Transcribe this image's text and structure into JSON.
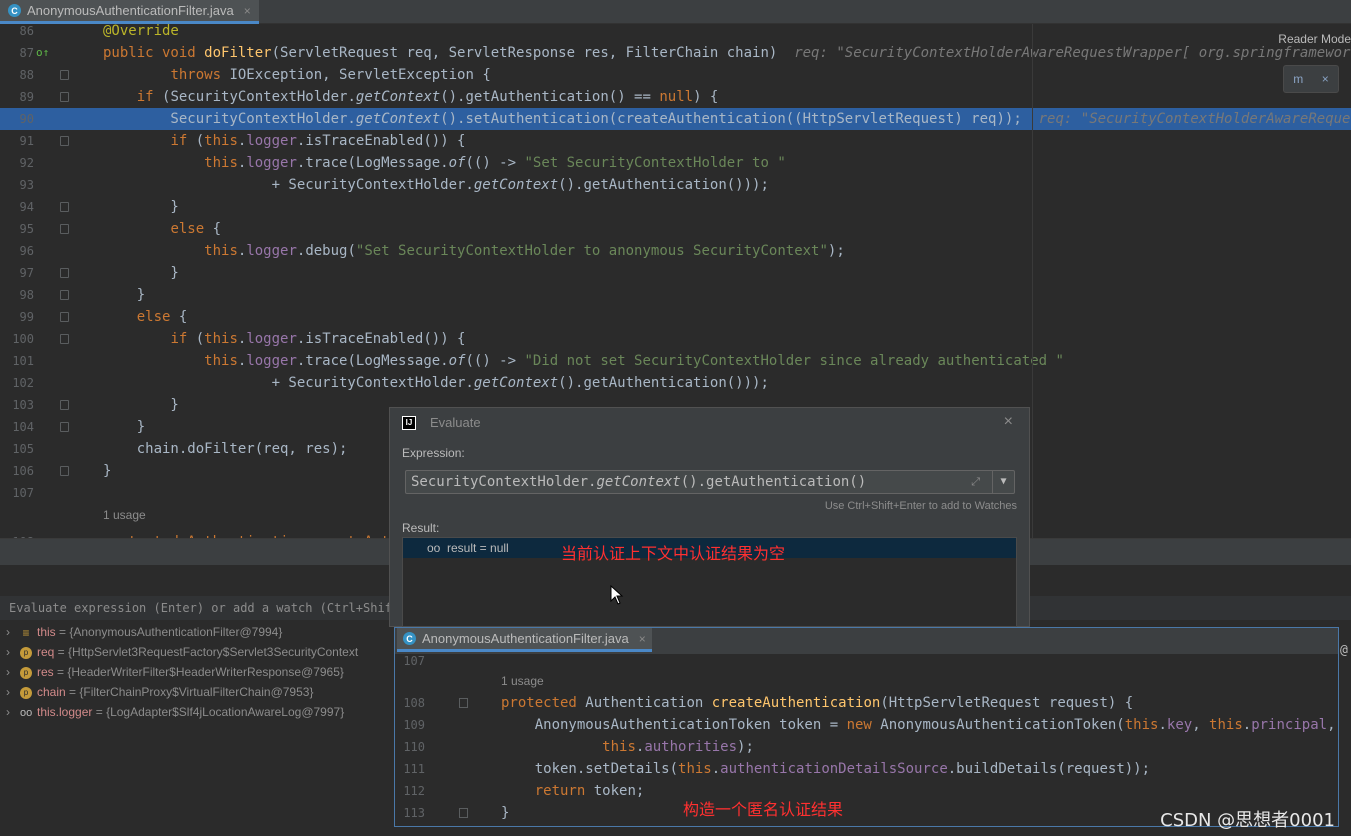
{
  "tab": {
    "icon": "C",
    "label": "AnonymousAuthenticationFilter.java",
    "close": "×"
  },
  "reader_mode": "Reader Mode",
  "maven_icon": "m",
  "maven_close": "×",
  "editor": {
    "lines": [
      {
        "n": "86",
        "parts": [
          {
            "c": "ann",
            "t": "@Override"
          }
        ]
      },
      {
        "n": "87",
        "parts": [
          {
            "c": "kw",
            "t": "public void "
          },
          {
            "c": "fn",
            "t": "doFilter"
          },
          {
            "c": "",
            "t": "(ServletRequest req, ServletResponse res, FilterChain chain)  "
          },
          {
            "c": "hint",
            "t": "req: \"SecurityContextHolderAwareRequestWrapper[ org.springframework.securi"
          }
        ]
      },
      {
        "n": "88",
        "parts": [
          {
            "c": "",
            "t": "        "
          },
          {
            "c": "kw",
            "t": "throws "
          },
          {
            "c": "",
            "t": "IOException, ServletException {"
          }
        ]
      },
      {
        "n": "89",
        "parts": [
          {
            "c": "",
            "t": "    "
          },
          {
            "c": "kw",
            "t": "if "
          },
          {
            "c": "",
            "t": "(SecurityContextHolder."
          },
          {
            "c": "it",
            "t": "getContext"
          },
          {
            "c": "",
            "t": "().getAuthentication() == "
          },
          {
            "c": "kw",
            "t": "null"
          },
          {
            "c": "",
            "t": ") {"
          }
        ]
      },
      {
        "n": "90",
        "hl": true,
        "parts": [
          {
            "c": "",
            "t": "        SecurityContextHolder."
          },
          {
            "c": "it",
            "t": "getContext"
          },
          {
            "c": "",
            "t": "().setAuthentication(createAuthentication((HttpServletRequest) req));  "
          },
          {
            "c": "hint",
            "t": "req: \"SecurityContextHolderAwareRequestWrappe"
          }
        ]
      },
      {
        "n": "91",
        "parts": [
          {
            "c": "",
            "t": "        "
          },
          {
            "c": "kw",
            "t": "if "
          },
          {
            "c": "",
            "t": "("
          },
          {
            "c": "kw",
            "t": "this"
          },
          {
            "c": "",
            "t": "."
          },
          {
            "c": "fld",
            "t": "logger"
          },
          {
            "c": "",
            "t": ".isTraceEnabled()) {"
          }
        ]
      },
      {
        "n": "92",
        "parts": [
          {
            "c": "",
            "t": "            "
          },
          {
            "c": "kw",
            "t": "this"
          },
          {
            "c": "",
            "t": "."
          },
          {
            "c": "fld",
            "t": "logger"
          },
          {
            "c": "",
            "t": ".trace(LogMessage."
          },
          {
            "c": "it",
            "t": "of"
          },
          {
            "c": "",
            "t": "(() -> "
          },
          {
            "c": "str",
            "t": "\"Set SecurityContextHolder to \""
          }
        ]
      },
      {
        "n": "93",
        "parts": [
          {
            "c": "",
            "t": "                    + SecurityContextHolder."
          },
          {
            "c": "it",
            "t": "getContext"
          },
          {
            "c": "",
            "t": "().getAuthentication()));"
          }
        ]
      },
      {
        "n": "94",
        "parts": [
          {
            "c": "",
            "t": "        }"
          }
        ]
      },
      {
        "n": "95",
        "parts": [
          {
            "c": "",
            "t": "        "
          },
          {
            "c": "kw",
            "t": "else "
          },
          {
            "c": "",
            "t": "{"
          }
        ]
      },
      {
        "n": "96",
        "parts": [
          {
            "c": "",
            "t": "            "
          },
          {
            "c": "kw",
            "t": "this"
          },
          {
            "c": "",
            "t": "."
          },
          {
            "c": "fld",
            "t": "logger"
          },
          {
            "c": "",
            "t": ".debug("
          },
          {
            "c": "str",
            "t": "\"Set SecurityContextHolder to anonymous SecurityContext\""
          },
          {
            "c": "",
            "t": ");"
          }
        ]
      },
      {
        "n": "97",
        "parts": [
          {
            "c": "",
            "t": "        }"
          }
        ]
      },
      {
        "n": "98",
        "parts": [
          {
            "c": "",
            "t": "    }"
          }
        ]
      },
      {
        "n": "99",
        "parts": [
          {
            "c": "",
            "t": "    "
          },
          {
            "c": "kw",
            "t": "else "
          },
          {
            "c": "",
            "t": "{"
          }
        ]
      },
      {
        "n": "100",
        "parts": [
          {
            "c": "",
            "t": "        "
          },
          {
            "c": "kw",
            "t": "if "
          },
          {
            "c": "",
            "t": "("
          },
          {
            "c": "kw",
            "t": "this"
          },
          {
            "c": "",
            "t": "."
          },
          {
            "c": "fld",
            "t": "logger"
          },
          {
            "c": "",
            "t": ".isTraceEnabled()) {"
          }
        ]
      },
      {
        "n": "101",
        "parts": [
          {
            "c": "",
            "t": "            "
          },
          {
            "c": "kw",
            "t": "this"
          },
          {
            "c": "",
            "t": "."
          },
          {
            "c": "fld",
            "t": "logger"
          },
          {
            "c": "",
            "t": ".trace(LogMessage."
          },
          {
            "c": "it",
            "t": "of"
          },
          {
            "c": "",
            "t": "(() -> "
          },
          {
            "c": "str",
            "t": "\"Did not set SecurityContextHolder since already authenticated \""
          }
        ]
      },
      {
        "n": "102",
        "parts": [
          {
            "c": "",
            "t": "                    + SecurityContextHolder."
          },
          {
            "c": "it",
            "t": "getContext"
          },
          {
            "c": "",
            "t": "().getAuthentication()));"
          }
        ]
      },
      {
        "n": "103",
        "parts": [
          {
            "c": "",
            "t": "        }"
          }
        ]
      },
      {
        "n": "104",
        "parts": [
          {
            "c": "",
            "t": "    }"
          }
        ]
      },
      {
        "n": "105",
        "parts": [
          {
            "c": "",
            "t": "    chain.doFilter(req, res);"
          }
        ]
      },
      {
        "n": "106",
        "parts": [
          {
            "c": "",
            "t": "}"
          }
        ]
      },
      {
        "n": "107",
        "parts": []
      }
    ],
    "usage": "1 usage",
    "line108_partial": "protected Authentication createAuthe"
  },
  "debug": {
    "eval_placeholder": "Evaluate expression (Enter) or add a watch (Ctrl+Shift",
    "vars": [
      {
        "name": "this",
        "value": "{AnonymousAuthenticationFilter@7994}",
        "icon": "≡"
      },
      {
        "name": "req",
        "value": "{HttpServlet3RequestFactory$Servlet3SecurityContext",
        "icon": "p"
      },
      {
        "name": "res",
        "value": "{HeaderWriterFilter$HeaderWriterResponse@7965}",
        "icon": "p"
      },
      {
        "name": "chain",
        "value": "{FilterChainProxy$VirtualFilterChain@7953}",
        "icon": "p"
      },
      {
        "name": "this.logger",
        "value": "{LogAdapter$Slf4jLocationAwareLog@7997}",
        "icon": "oo"
      }
    ]
  },
  "evaluate": {
    "title": "Evaluate",
    "close": "×",
    "expression_label": "Expression:",
    "expression": "SecurityContextHolder.getContext().getAuthentication()",
    "hint": "Use Ctrl+Shift+Enter to add to Watches",
    "result_label": "Result:",
    "result": "result = null",
    "annotation": "当前认证上下文中认证结果为空"
  },
  "popup": {
    "tab_label": "AnonymousAuthenticationFilter.java",
    "usage": "1 usage",
    "lines": [
      {
        "n": "107",
        "parts": []
      },
      {
        "n": "108",
        "parts": [
          {
            "c": "kw",
            "t": "protected "
          },
          {
            "c": "",
            "t": "Authentication "
          },
          {
            "c": "fn",
            "t": "createAuthentication"
          },
          {
            "c": "",
            "t": "(HttpServletRequest request) {"
          }
        ]
      },
      {
        "n": "109",
        "parts": [
          {
            "c": "",
            "t": "    AnonymousAuthenticationToken token = "
          },
          {
            "c": "kw",
            "t": "new "
          },
          {
            "c": "",
            "t": "AnonymousAuthenticationToken("
          },
          {
            "c": "kw",
            "t": "this"
          },
          {
            "c": "",
            "t": "."
          },
          {
            "c": "fld",
            "t": "key"
          },
          {
            "c": "",
            "t": ", "
          },
          {
            "c": "kw",
            "t": "this"
          },
          {
            "c": "",
            "t": "."
          },
          {
            "c": "fld",
            "t": "principal"
          },
          {
            "c": "",
            "t": ","
          }
        ]
      },
      {
        "n": "110",
        "parts": [
          {
            "c": "",
            "t": "            "
          },
          {
            "c": "kw",
            "t": "this"
          },
          {
            "c": "",
            "t": "."
          },
          {
            "c": "fld",
            "t": "authorities"
          },
          {
            "c": "",
            "t": ");"
          }
        ]
      },
      {
        "n": "111",
        "parts": [
          {
            "c": "",
            "t": "    token.setDetails("
          },
          {
            "c": "kw",
            "t": "this"
          },
          {
            "c": "",
            "t": "."
          },
          {
            "c": "fld",
            "t": "authenticationDetailsSource"
          },
          {
            "c": "",
            "t": ".buildDetails(request));"
          }
        ]
      },
      {
        "n": "112",
        "parts": [
          {
            "c": "",
            "t": "    "
          },
          {
            "c": "kw",
            "t": "return "
          },
          {
            "c": "",
            "t": "token;"
          }
        ]
      },
      {
        "n": "113",
        "parts": [
          {
            "c": "",
            "t": "}"
          }
        ]
      }
    ],
    "annotation": "构造一个匿名认证结果"
  },
  "watermark": "CSDN @思想者0001",
  "at_sign": "@"
}
